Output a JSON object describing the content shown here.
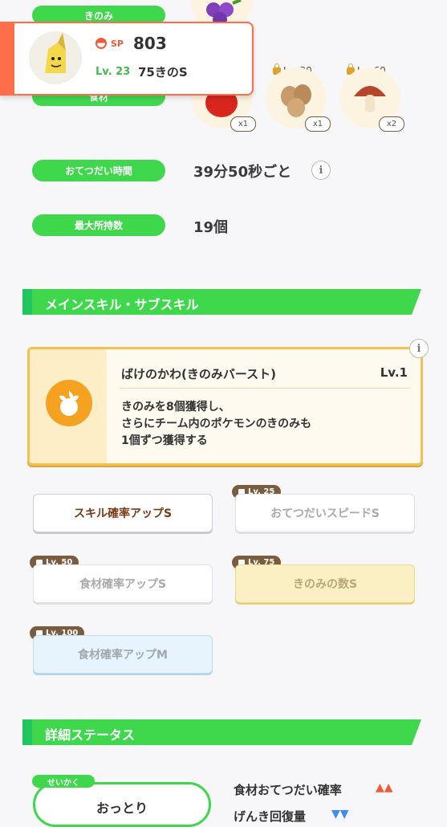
{
  "labels": {
    "berry": "きのみ",
    "ingredients": "食材",
    "help_time": "おてつだい時間",
    "max_carry": "最大所持数"
  },
  "values": {
    "help_time": "39分50秒ごと",
    "max_carry": "19個"
  },
  "pokemon_card": {
    "sp_label": "SP",
    "sp_value": "803",
    "level": "Lv. 23",
    "sub_skill": "75きのS"
  },
  "ingredients": [
    {
      "name": "apple",
      "count": "x1"
    },
    {
      "name": "almond",
      "lock": "Lv. 30",
      "count": "x1"
    },
    {
      "name": "mushroom",
      "lock": "Lv. 60",
      "count": "x2"
    }
  ],
  "sections": {
    "skills": "メインスキル・サブスキル",
    "details": "詳細ステータス"
  },
  "main_skill": {
    "name": "ばけのかわ(きのみバースト)",
    "level": "Lv.1",
    "description_lines": [
      "きのみを8個獲得し、",
      "さらにチーム内のポケモンのきのみも",
      "1個ずつ獲得する"
    ]
  },
  "sub_skills": [
    {
      "label": "スキル確率アップS",
      "lock": "",
      "style": "white-active"
    },
    {
      "label": "おてつだいスピードS",
      "lock": "Lv. 25",
      "style": "white"
    },
    {
      "label": "食材確率アップS",
      "lock": "Lv. 50",
      "style": "white"
    },
    {
      "label": "きのみの数S",
      "lock": "Lv. 75",
      "style": "gold"
    },
    {
      "label": "食材確率アップM",
      "lock": "Lv. 100",
      "style": "blue"
    }
  ],
  "nature": {
    "tag": "せいかく",
    "value": "おっとり",
    "up_label": "食材おてつだい確率",
    "up_marks": "▲▲",
    "down_label": "げんき回復量",
    "down_marks": "▼▼"
  },
  "colors": {
    "accent_green": "#3fd84d",
    "card_orange": "#ff6e4a",
    "skill_gold": "#f2c14e",
    "up_red": "#ef5b3a",
    "down_blue": "#3b8cf0"
  }
}
